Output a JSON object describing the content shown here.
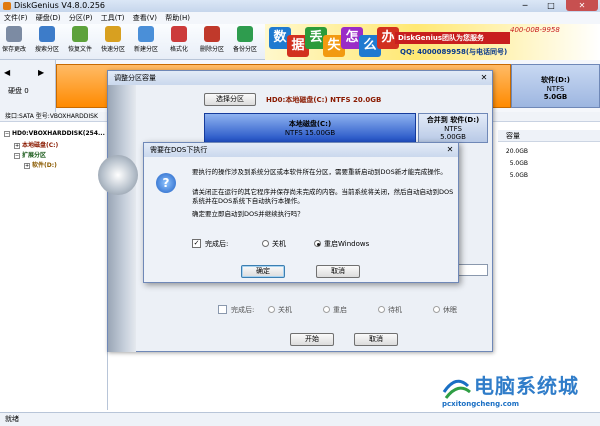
{
  "window": {
    "title": "DiskGenius V4.8.0.256",
    "controls": {
      "min": "─",
      "max": "□",
      "close": "✕"
    }
  },
  "menu": [
    "文件(F)",
    "硬盘(D)",
    "分区(P)",
    "工具(T)",
    "查看(V)",
    "帮助(H)"
  ],
  "toolbar": [
    {
      "label": "保存更改",
      "icon": "save-icon",
      "color": "#7c8ba3"
    },
    {
      "label": "搜索分区",
      "icon": "search-icon",
      "color": "#3d7cc9"
    },
    {
      "label": "恢复文件",
      "icon": "recover-icon",
      "color": "#5da23c"
    },
    {
      "label": "快速分区",
      "icon": "quick-partition-icon",
      "color": "#d8a020"
    },
    {
      "label": "新建分区",
      "icon": "new-partition-icon",
      "color": "#4a8fd8"
    },
    {
      "label": "格式化",
      "icon": "format-icon",
      "color": "#cc3b3b"
    },
    {
      "label": "删除分区",
      "icon": "delete-partition-icon",
      "color": "#c0392b"
    },
    {
      "label": "备份分区",
      "icon": "backup-icon",
      "color": "#2e9c4e"
    }
  ],
  "banner": {
    "chars": [
      "数",
      "据",
      "丢",
      "失",
      "怎",
      "么",
      "办"
    ],
    "char_colors": [
      "#1f7ad0",
      "#d2301f",
      "#2b9b3a",
      "#f29a11",
      "#9a2cc7",
      "#1f7ad0",
      "#d2301f"
    ],
    "brand": "DiskGenius团队为您服务",
    "hotline": "400-00B-9958",
    "qq": "QQ: 4000089958(与电话同号)"
  },
  "disk_panel": {
    "nav_left": "◀",
    "nav_right": "▶",
    "disk_label": "硬盘 0",
    "interface_text": "接口:SATA  型号:VBOXHARDDISK"
  },
  "disk_map": {
    "d": {
      "name": "软件(D:)",
      "fs": "NTFS",
      "size": "5.0GB"
    }
  },
  "tree": {
    "disk": "HD0:VBOXHARDDISK(254...",
    "c": "本地磁盘(C:)",
    "ext": "扩展分区",
    "d": "软件(D:)"
  },
  "right_panel": {
    "header": "容量",
    "rows": [
      "20.0GB",
      "5.0GB",
      "5.0GB"
    ]
  },
  "status": "就绪",
  "resize_dialog": {
    "title": "调整分区容量",
    "close": "✕",
    "select_button": "选择分区",
    "hdd_label": "HD0:本地磁盘(C:) NTFS 20.0GB",
    "part_c": {
      "name": "本地磁盘(C:)",
      "fs": "NTFS 15.00GB"
    },
    "part_d": {
      "name": "合并到 软件(D:)",
      "fs": "NTFS",
      "size": "5.00GB"
    },
    "after_label": "完成后:",
    "after_options": [
      "关机",
      "重启",
      "待机",
      "休眠"
    ],
    "start_button": "开始",
    "cancel_button": "取消"
  },
  "dos_dialog": {
    "title": "需要在DOS下执行",
    "close": "✕",
    "icon_glyph": "?",
    "message1": "要执行的操作涉及到系统分区或本软件所在分区，需要重新启动到DOS新才能完成操作。",
    "message2": "请关闭正在运行的其它程序并保存尚未完成的内容。当前系统将关闭，然后自动启动到DOS系统并在DOS系统下自动执行本操作。",
    "message3": "确定要立即启动到DOS并继续执行吗？",
    "after_label": "完成后:",
    "after_checked": "✓",
    "option_shutdown": "关机",
    "option_restart": "重启Windows",
    "ok_button": "确定",
    "cancel_button": "取消"
  },
  "watermark": {
    "big": "电脑系统城",
    "small": "pcxitongcheng.com"
  }
}
